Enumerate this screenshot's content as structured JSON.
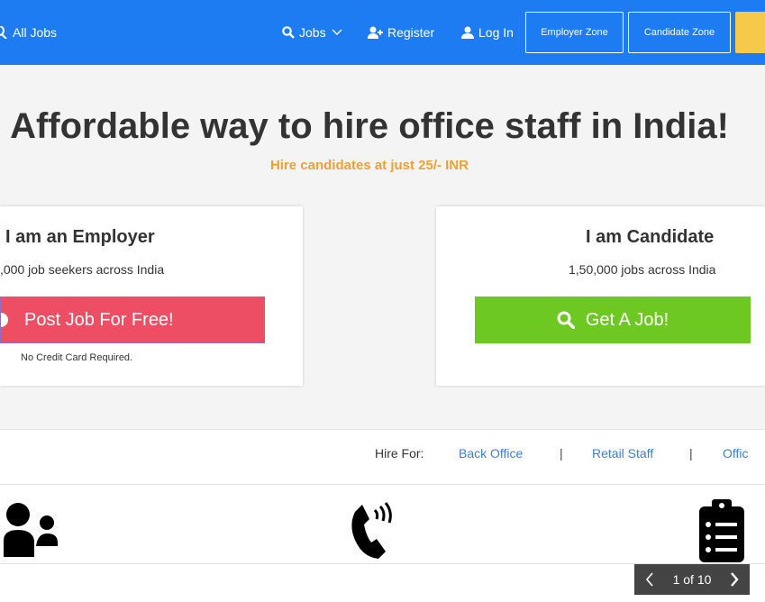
{
  "nav": {
    "all_jobs": "All Jobs",
    "jobs": "Jobs",
    "register": "Register",
    "login": "Log In",
    "employer_zone": "Employer Zone",
    "candidate_zone": "Candidate Zone"
  },
  "hero": {
    "title": "Affordable way to hire office staff in India!",
    "subtitle": "Hire candidates at just 25/- INR"
  },
  "employer_card": {
    "title": "I am an Employer",
    "text": ",000 job seekers across India",
    "button": "Post Job For Free!",
    "note": "No Credit Card Required."
  },
  "candidate_card": {
    "title": "I am Candidate",
    "text": "1,50,000 jobs across India",
    "button": "Get A Job!"
  },
  "hire_for": {
    "label": "Hire For:",
    "items": [
      "Back Office",
      "Retail Staff",
      "Offic"
    ],
    "separator": "|"
  },
  "pager": {
    "text": "1 of 10"
  },
  "icons": [
    "search-icon",
    "chevron-down-icon",
    "add-user-icon",
    "user-icon",
    "users-icon",
    "phone-icon",
    "clipboard-list-icon",
    "chevron-left-icon",
    "chevron-right-icon"
  ],
  "colors": {
    "nav_bg": "#1e7cf2",
    "accent_orange": "#f0a030",
    "post_job_red": "#ee4e63",
    "get_job_green": "#6dc822",
    "link_blue": "#3b7fd4",
    "pager_bg": "#444444"
  }
}
